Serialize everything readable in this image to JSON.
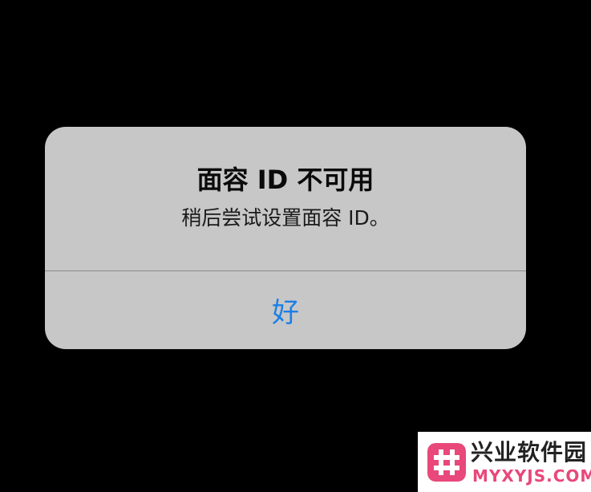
{
  "alert": {
    "title": "面容 ID 不可用",
    "message": "稍后尝试设置面容 ID。",
    "ok_label": "好"
  },
  "watermark": {
    "name": "兴业软件园",
    "domain": "MYXYJS.COM"
  },
  "colors": {
    "background": "#000000",
    "alert_background": "#c7c7c7",
    "button_blue": "#1a7fe8",
    "watermark_accent": "#e8487a"
  },
  "icons": {
    "watermark_logo": "hash-icon"
  }
}
